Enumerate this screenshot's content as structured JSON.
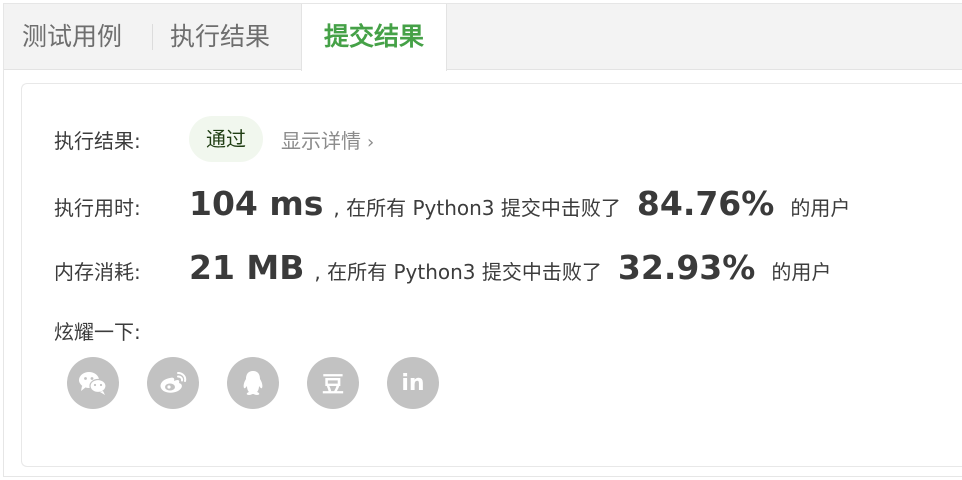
{
  "tabs": [
    {
      "label": "测试用例"
    },
    {
      "label": "执行结果"
    },
    {
      "label": "提交结果",
      "active": true
    }
  ],
  "result": {
    "label": "执行结果:",
    "status": "通过",
    "details_label": "显示详情",
    "details_chevron": "›"
  },
  "runtime": {
    "label": "执行用时:",
    "value": "104 ms",
    "text": ", 在所有 Python3 提交中击败了",
    "percent": "84.76%",
    "suffix": "的用户"
  },
  "memory": {
    "label": "内存消耗:",
    "value": "21 MB",
    "text": ", 在所有 Python3 提交中击败了",
    "percent": "32.93%",
    "suffix": "的用户"
  },
  "share": {
    "label": "炫耀一下:",
    "buttons": [
      {
        "icon": "wechat-icon"
      },
      {
        "icon": "weibo-icon"
      },
      {
        "icon": "qq-icon"
      },
      {
        "icon": "douban-icon",
        "glyph": "豆"
      },
      {
        "icon": "linkedin-icon",
        "glyph": "in"
      }
    ]
  },
  "colors": {
    "accent": "#45a147",
    "badge_bg": "#f1f7ee",
    "icon_gray": "#c2c2c2"
  }
}
